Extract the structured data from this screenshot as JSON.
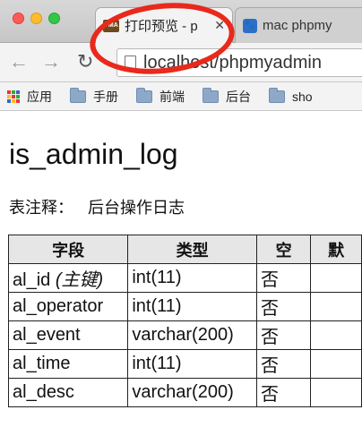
{
  "browser": {
    "tabs": [
      {
        "title": "打印预览 - p",
        "favicon": "PMA",
        "active": true
      },
      {
        "title": "mac phpmy",
        "favicon": "paw-icon",
        "active": false
      }
    ],
    "url": "localhost/phpmyadmin",
    "bookmarks": [
      {
        "label": "应用",
        "icon": "apps-icon"
      },
      {
        "label": "手册",
        "icon": "folder-icon"
      },
      {
        "label": "前端",
        "icon": "folder-icon"
      },
      {
        "label": "后台",
        "icon": "folder-icon"
      },
      {
        "label": "sho",
        "icon": "folder-icon"
      }
    ],
    "annotation_color": "#e8291c"
  },
  "page": {
    "table_name": "is_admin_log",
    "comment_label": "表注释：",
    "comment_value": "后台操作日志",
    "columns": [
      "字段",
      "类型",
      "空",
      "默"
    ],
    "rows": [
      {
        "field": "al_id",
        "key_note": "(主键)",
        "type": "int(11)",
        "null": "否",
        "default": ""
      },
      {
        "field": "al_operator",
        "key_note": "",
        "type": "int(11)",
        "null": "否",
        "default": ""
      },
      {
        "field": "al_event",
        "key_note": "",
        "type": "varchar(200)",
        "null": "否",
        "default": ""
      },
      {
        "field": "al_time",
        "key_note": "",
        "type": "int(11)",
        "null": "否",
        "default": ""
      },
      {
        "field": "al_desc",
        "key_note": "",
        "type": "varchar(200)",
        "null": "否",
        "default": ""
      }
    ]
  }
}
